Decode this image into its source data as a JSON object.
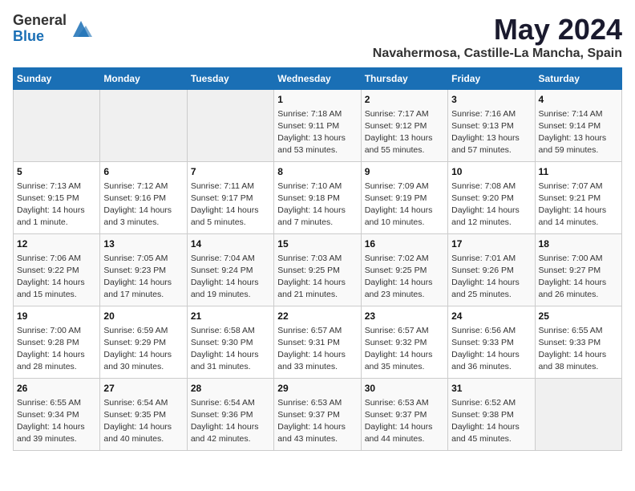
{
  "logo": {
    "general": "General",
    "blue": "Blue"
  },
  "title": "May 2024",
  "subtitle": "Navahermosa, Castille-La Mancha, Spain",
  "headers": [
    "Sunday",
    "Monday",
    "Tuesday",
    "Wednesday",
    "Thursday",
    "Friday",
    "Saturday"
  ],
  "weeks": [
    [
      {
        "day": "",
        "info": ""
      },
      {
        "day": "",
        "info": ""
      },
      {
        "day": "",
        "info": ""
      },
      {
        "day": "1",
        "info": "Sunrise: 7:18 AM\nSunset: 9:11 PM\nDaylight: 13 hours\nand 53 minutes."
      },
      {
        "day": "2",
        "info": "Sunrise: 7:17 AM\nSunset: 9:12 PM\nDaylight: 13 hours\nand 55 minutes."
      },
      {
        "day": "3",
        "info": "Sunrise: 7:16 AM\nSunset: 9:13 PM\nDaylight: 13 hours\nand 57 minutes."
      },
      {
        "day": "4",
        "info": "Sunrise: 7:14 AM\nSunset: 9:14 PM\nDaylight: 13 hours\nand 59 minutes."
      }
    ],
    [
      {
        "day": "5",
        "info": "Sunrise: 7:13 AM\nSunset: 9:15 PM\nDaylight: 14 hours\nand 1 minute."
      },
      {
        "day": "6",
        "info": "Sunrise: 7:12 AM\nSunset: 9:16 PM\nDaylight: 14 hours\nand 3 minutes."
      },
      {
        "day": "7",
        "info": "Sunrise: 7:11 AM\nSunset: 9:17 PM\nDaylight: 14 hours\nand 5 minutes."
      },
      {
        "day": "8",
        "info": "Sunrise: 7:10 AM\nSunset: 9:18 PM\nDaylight: 14 hours\nand 7 minutes."
      },
      {
        "day": "9",
        "info": "Sunrise: 7:09 AM\nSunset: 9:19 PM\nDaylight: 14 hours\nand 10 minutes."
      },
      {
        "day": "10",
        "info": "Sunrise: 7:08 AM\nSunset: 9:20 PM\nDaylight: 14 hours\nand 12 minutes."
      },
      {
        "day": "11",
        "info": "Sunrise: 7:07 AM\nSunset: 9:21 PM\nDaylight: 14 hours\nand 14 minutes."
      }
    ],
    [
      {
        "day": "12",
        "info": "Sunrise: 7:06 AM\nSunset: 9:22 PM\nDaylight: 14 hours\nand 15 minutes."
      },
      {
        "day": "13",
        "info": "Sunrise: 7:05 AM\nSunset: 9:23 PM\nDaylight: 14 hours\nand 17 minutes."
      },
      {
        "day": "14",
        "info": "Sunrise: 7:04 AM\nSunset: 9:24 PM\nDaylight: 14 hours\nand 19 minutes."
      },
      {
        "day": "15",
        "info": "Sunrise: 7:03 AM\nSunset: 9:25 PM\nDaylight: 14 hours\nand 21 minutes."
      },
      {
        "day": "16",
        "info": "Sunrise: 7:02 AM\nSunset: 9:25 PM\nDaylight: 14 hours\nand 23 minutes."
      },
      {
        "day": "17",
        "info": "Sunrise: 7:01 AM\nSunset: 9:26 PM\nDaylight: 14 hours\nand 25 minutes."
      },
      {
        "day": "18",
        "info": "Sunrise: 7:00 AM\nSunset: 9:27 PM\nDaylight: 14 hours\nand 26 minutes."
      }
    ],
    [
      {
        "day": "19",
        "info": "Sunrise: 7:00 AM\nSunset: 9:28 PM\nDaylight: 14 hours\nand 28 minutes."
      },
      {
        "day": "20",
        "info": "Sunrise: 6:59 AM\nSunset: 9:29 PM\nDaylight: 14 hours\nand 30 minutes."
      },
      {
        "day": "21",
        "info": "Sunrise: 6:58 AM\nSunset: 9:30 PM\nDaylight: 14 hours\nand 31 minutes."
      },
      {
        "day": "22",
        "info": "Sunrise: 6:57 AM\nSunset: 9:31 PM\nDaylight: 14 hours\nand 33 minutes."
      },
      {
        "day": "23",
        "info": "Sunrise: 6:57 AM\nSunset: 9:32 PM\nDaylight: 14 hours\nand 35 minutes."
      },
      {
        "day": "24",
        "info": "Sunrise: 6:56 AM\nSunset: 9:33 PM\nDaylight: 14 hours\nand 36 minutes."
      },
      {
        "day": "25",
        "info": "Sunrise: 6:55 AM\nSunset: 9:33 PM\nDaylight: 14 hours\nand 38 minutes."
      }
    ],
    [
      {
        "day": "26",
        "info": "Sunrise: 6:55 AM\nSunset: 9:34 PM\nDaylight: 14 hours\nand 39 minutes."
      },
      {
        "day": "27",
        "info": "Sunrise: 6:54 AM\nSunset: 9:35 PM\nDaylight: 14 hours\nand 40 minutes."
      },
      {
        "day": "28",
        "info": "Sunrise: 6:54 AM\nSunset: 9:36 PM\nDaylight: 14 hours\nand 42 minutes."
      },
      {
        "day": "29",
        "info": "Sunrise: 6:53 AM\nSunset: 9:37 PM\nDaylight: 14 hours\nand 43 minutes."
      },
      {
        "day": "30",
        "info": "Sunrise: 6:53 AM\nSunset: 9:37 PM\nDaylight: 14 hours\nand 44 minutes."
      },
      {
        "day": "31",
        "info": "Sunrise: 6:52 AM\nSunset: 9:38 PM\nDaylight: 14 hours\nand 45 minutes."
      },
      {
        "day": "",
        "info": ""
      }
    ]
  ]
}
